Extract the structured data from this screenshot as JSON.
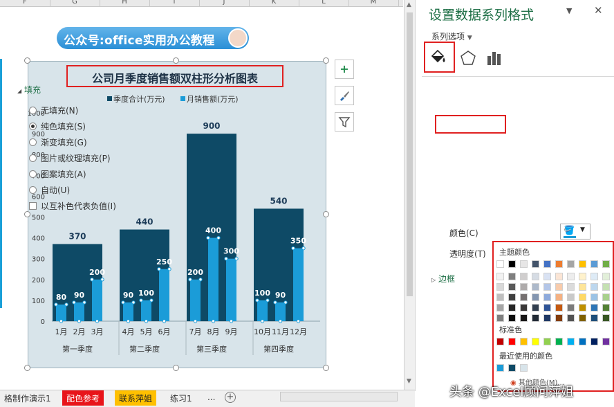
{
  "spreadsheet": {
    "columns": [
      "F",
      "G",
      "H",
      "I",
      "J",
      "K",
      "L",
      "M"
    ],
    "banner_text": "公众号:office实用办公教程"
  },
  "chart_data": {
    "type": "bar",
    "title": "公司月季度销售额双柱形分析图表",
    "ylim": [
      0,
      1000
    ],
    "yticks": [
      0,
      100,
      200,
      300,
      400,
      500,
      600,
      700,
      800,
      900,
      1000
    ],
    "legend_position": "top",
    "series": [
      {
        "name": "季度合计(万元)",
        "color": "#0e4a66",
        "values": [
          370,
          440,
          900,
          540
        ]
      },
      {
        "name": "月销售额(万元)",
        "color": "#1b9cd8",
        "values": [
          80,
          90,
          200,
          90,
          100,
          250,
          200,
          400,
          300,
          100,
          90,
          350
        ]
      }
    ],
    "quarters": [
      "第一季度",
      "第二季度",
      "第三季度",
      "第四季度"
    ],
    "months": [
      "1月",
      "2月",
      "3月",
      "4月",
      "5月",
      "6月",
      "7月",
      "8月",
      "9月",
      "10月",
      "11月",
      "12月"
    ]
  },
  "chart_tools": {
    "add_element_icon": "plus-icon",
    "style_icon": "brush-icon",
    "filter_icon": "filter-icon"
  },
  "format_pane": {
    "title": "设置数据系列格式",
    "series_options_label": "系列选项",
    "fill_section_label": "填充",
    "options": [
      {
        "label": "无填充(N)",
        "selected": false
      },
      {
        "label": "纯色填充(S)",
        "selected": true
      },
      {
        "label": "渐变填充(G)",
        "selected": false
      },
      {
        "label": "图片或纹理填充(P)",
        "selected": false
      },
      {
        "label": "图案填充(A)",
        "selected": false
      },
      {
        "label": "自动(U)",
        "selected": false
      }
    ],
    "invert_label": "以互补色代表负值(I)",
    "color_label": "颜色(C)",
    "transparency_label": "透明度(T)",
    "border_section_label": "边框"
  },
  "color_popup": {
    "theme_label": "主题颜色",
    "standard_label": "标准色",
    "recent_label": "最近使用的颜色",
    "more_label": "其他颜色(M)...",
    "theme_top": [
      "#ffffff",
      "#000000",
      "#e7e6e6",
      "#44546a",
      "#4472c4",
      "#ed7d31",
      "#a5a5a5",
      "#ffc000",
      "#5b9bd5",
      "#70ad47"
    ],
    "theme_shades": [
      [
        "#f2f2f2",
        "#7f7f7f",
        "#d0cece",
        "#d6dce4",
        "#d9e2f3",
        "#fbe5d5",
        "#ededed",
        "#fff2cc",
        "#deebf6",
        "#e2efd9"
      ],
      [
        "#d8d8d8",
        "#595959",
        "#aeabab",
        "#adb9ca",
        "#b4c6e7",
        "#f7cbac",
        "#dbdbdb",
        "#fee599",
        "#bdd7ee",
        "#c5e0b3"
      ],
      [
        "#bfbfbf",
        "#3f3f3f",
        "#757070",
        "#8496b0",
        "#8eaadb",
        "#f4b183",
        "#c9c9c9",
        "#ffd965",
        "#9cc3e5",
        "#a8d08d"
      ],
      [
        "#a5a5a5",
        "#262626",
        "#3a3838",
        "#323f4f",
        "#2f5496",
        "#c45911",
        "#7b7b7b",
        "#bf9000",
        "#2e75b5",
        "#538135"
      ],
      [
        "#7f7f7f",
        "#0c0c0c",
        "#171616",
        "#222a35",
        "#1f3864",
        "#833c0b",
        "#525252",
        "#7f6000",
        "#1e4e79",
        "#375623"
      ]
    ],
    "standard": [
      "#c00000",
      "#ff0000",
      "#ffc000",
      "#ffff00",
      "#92d050",
      "#00b050",
      "#00b0f0",
      "#0070c0",
      "#002060",
      "#7030a0"
    ],
    "recent": [
      "#1b9cd8",
      "#0e4a66",
      "#d8e4ea"
    ]
  },
  "sheet_tabs": [
    {
      "label": "格制作演示1",
      "style": "plain"
    },
    {
      "label": "配色参考",
      "style": "red"
    },
    {
      "label": "联系萍姐",
      "style": "yellow"
    },
    {
      "label": "练习1",
      "style": "plain"
    }
  ],
  "sheet_nav": {
    "more": "...",
    "add": "+"
  },
  "watermark": "头条 @Excel顾问萍姐"
}
